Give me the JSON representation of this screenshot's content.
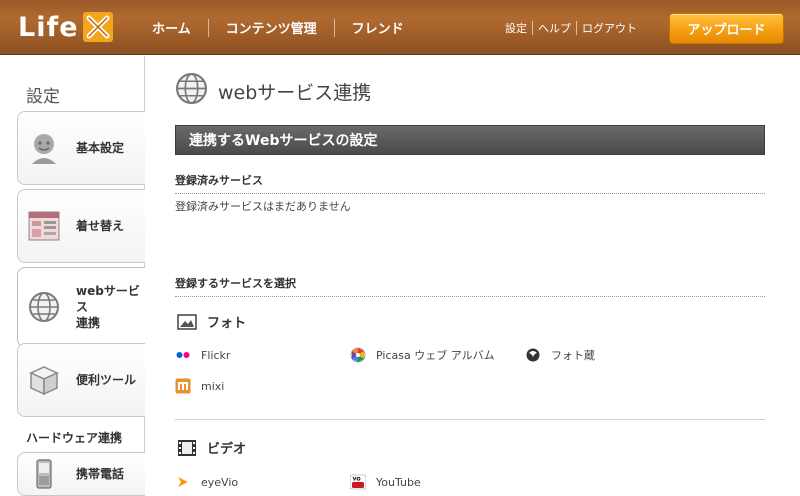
{
  "header": {
    "logo_text": "Life",
    "nav": [
      "ホーム",
      "コンテンツ管理",
      "フレンド"
    ],
    "util": [
      "設定",
      "ヘルプ",
      "ログアウト"
    ],
    "upload_label": "アップロード"
  },
  "sidebar": {
    "title": "設定",
    "items": [
      {
        "label": "基本設定",
        "icon": "user-icon"
      },
      {
        "label": "着せ替え",
        "icon": "skin-icon"
      },
      {
        "label": "webサービス\n連携",
        "icon": "globe-icon"
      },
      {
        "label": "便利ツール",
        "icon": "box-icon"
      }
    ],
    "hardware_title": "ハードウェア連携",
    "hardware_items": [
      {
        "label": "携帯電話",
        "icon": "phone-icon"
      }
    ]
  },
  "main": {
    "title": "webサービス連携",
    "section_title": "連携するWebサービスの設定",
    "registered_heading": "登録済みサービス",
    "registered_note": "登録済みサービスはまだありません",
    "select_heading": "登録するサービスを選択",
    "categories": [
      {
        "name": "フォト",
        "icon": "photo-icon",
        "services": [
          "Flickr",
          "Picasa ウェブ アルバム",
          "フォト蔵",
          "mixi"
        ]
      },
      {
        "name": "ビデオ",
        "icon": "film-icon",
        "services": [
          "eyeVio",
          "YouTube"
        ]
      }
    ]
  },
  "colors": {
    "header_brown": "#9a5a28",
    "upload_orange": "#f59f12",
    "section_bar": "#555555"
  }
}
